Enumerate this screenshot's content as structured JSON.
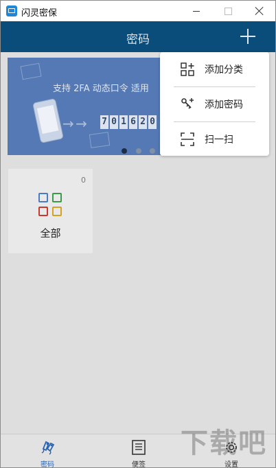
{
  "window": {
    "title": "闪灵密保"
  },
  "header": {
    "title": "密码",
    "add_icon": "plus-icon"
  },
  "banner": {
    "text": "支持 2FA 动态口令   适用",
    "code_digits": [
      "7",
      "0",
      "1",
      "6",
      "2",
      "0"
    ],
    "slide_count": 4,
    "active_slide": 1
  },
  "categories": [
    {
      "label": "全部",
      "count": "0",
      "icon": "grid-icon"
    }
  ],
  "menu": {
    "items": [
      {
        "label": "添加分类",
        "icon": "add-category-icon"
      },
      {
        "label": "添加密码",
        "icon": "add-key-icon"
      },
      {
        "label": "扫一扫",
        "icon": "scan-icon"
      }
    ]
  },
  "bottom_nav": [
    {
      "label": "密码",
      "icon": "keys-icon",
      "active": true
    },
    {
      "label": "便签",
      "icon": "notepad-icon",
      "active": false
    },
    {
      "label": "设置",
      "icon": "gear-icon",
      "active": false
    }
  ],
  "watermark": "下载吧",
  "colors": {
    "header": "#0a4d7a",
    "accent": "#2a64b1",
    "banner": "#5579b4"
  }
}
